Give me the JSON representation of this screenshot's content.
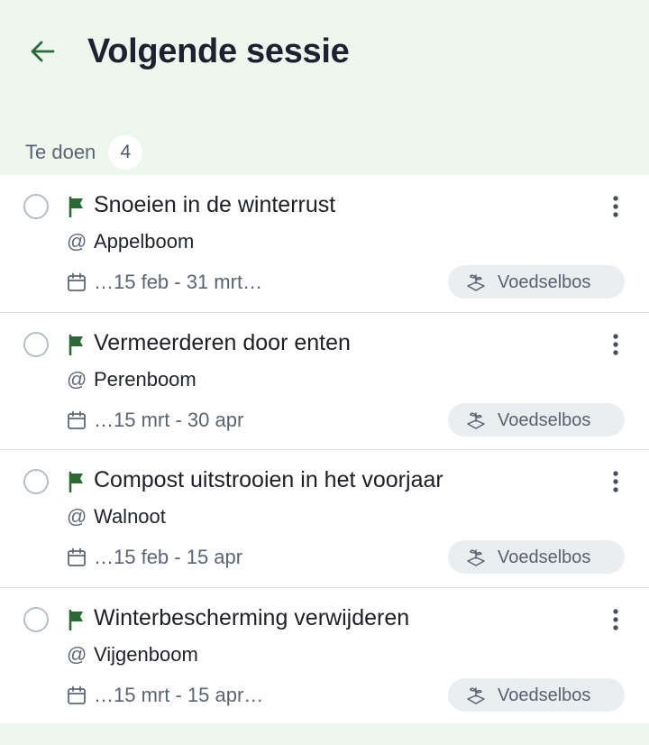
{
  "header": {
    "title": "Volgende sessie"
  },
  "section": {
    "label": "Te doen",
    "count": "4"
  },
  "colors": {
    "accent": "#2a6b35",
    "background": "#eef7ee",
    "chip": "#ebeef1"
  },
  "icons": {
    "back": "arrow-left-icon",
    "flag": "flag-icon",
    "more": "more-vertical-icon",
    "calendar": "calendar-icon",
    "chip": "garden-plant-icon"
  },
  "tasks": [
    {
      "title": "Snoeien in de winterrust",
      "at": "@",
      "location": "Appelboom",
      "dates": "…15 feb - 31 mrt…",
      "tag": "Voedselbos"
    },
    {
      "title": "Vermeerderen door enten",
      "at": "@",
      "location": "Perenboom",
      "dates": "…15 mrt - 30 apr",
      "tag": "Voedselbos"
    },
    {
      "title": "Compost uitstrooien in het voorjaar",
      "at": "@",
      "location": "Walnoot",
      "dates": "…15 feb - 15 apr",
      "tag": "Voedselbos"
    },
    {
      "title": "Winterbescherming verwijderen",
      "at": "@",
      "location": "Vijgenboom",
      "dates": "…15 mrt - 15 apr…",
      "tag": "Voedselbos"
    }
  ]
}
